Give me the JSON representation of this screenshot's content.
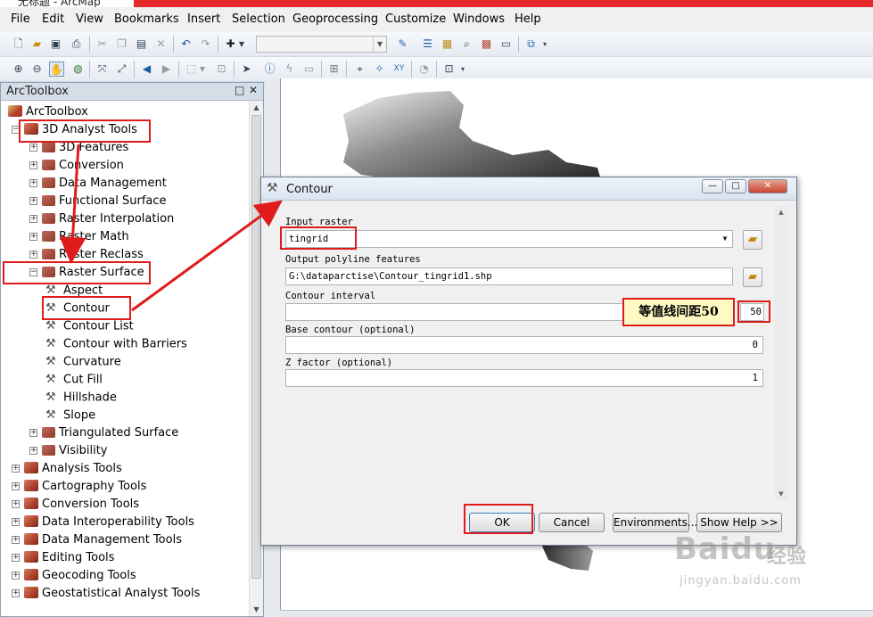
{
  "window": {
    "title_fragment": "无标题 - ArcMap"
  },
  "menu": [
    "File",
    "Edit",
    "View",
    "Bookmarks",
    "Insert",
    "Selection",
    "Geoprocessing",
    "Customize",
    "Windows",
    "Help"
  ],
  "toolbox_panel": {
    "title": "ArcToolbox",
    "pin_label": "□",
    "close_label": "✕",
    "root": "ArcToolbox",
    "items": [
      {
        "label": "3D Analyst Tools",
        "level": 0,
        "expanded": true,
        "kind": "toolbox"
      },
      {
        "label": "3D Features",
        "level": 1,
        "expanded": false,
        "kind": "toolset"
      },
      {
        "label": "Conversion",
        "level": 1,
        "expanded": false,
        "kind": "toolset"
      },
      {
        "label": "Data Management",
        "level": 1,
        "expanded": false,
        "kind": "toolset"
      },
      {
        "label": "Functional Surface",
        "level": 1,
        "expanded": false,
        "kind": "toolset"
      },
      {
        "label": "Raster Interpolation",
        "level": 1,
        "expanded": false,
        "kind": "toolset"
      },
      {
        "label": "Raster Math",
        "level": 1,
        "expanded": false,
        "kind": "toolset"
      },
      {
        "label": "Raster Reclass",
        "level": 1,
        "expanded": false,
        "kind": "toolset"
      },
      {
        "label": "Raster Surface",
        "level": 1,
        "expanded": true,
        "kind": "toolset"
      },
      {
        "label": "Aspect",
        "level": 2,
        "kind": "tool"
      },
      {
        "label": "Contour",
        "level": 2,
        "kind": "tool"
      },
      {
        "label": "Contour List",
        "level": 2,
        "kind": "tool"
      },
      {
        "label": "Contour with Barriers",
        "level": 2,
        "kind": "tool"
      },
      {
        "label": "Curvature",
        "level": 2,
        "kind": "tool"
      },
      {
        "label": "Cut Fill",
        "level": 2,
        "kind": "tool"
      },
      {
        "label": "Hillshade",
        "level": 2,
        "kind": "tool"
      },
      {
        "label": "Slope",
        "level": 2,
        "kind": "tool"
      },
      {
        "label": "Triangulated Surface",
        "level": 1,
        "expanded": false,
        "kind": "toolset"
      },
      {
        "label": "Visibility",
        "level": 1,
        "expanded": false,
        "kind": "toolset"
      },
      {
        "label": "Analysis Tools",
        "level": 0,
        "expanded": false,
        "kind": "toolbox"
      },
      {
        "label": "Cartography Tools",
        "level": 0,
        "expanded": false,
        "kind": "toolbox"
      },
      {
        "label": "Conversion Tools",
        "level": 0,
        "expanded": false,
        "kind": "toolbox"
      },
      {
        "label": "Data Interoperability Tools",
        "level": 0,
        "expanded": false,
        "kind": "toolbox"
      },
      {
        "label": "Data Management Tools",
        "level": 0,
        "expanded": false,
        "kind": "toolbox"
      },
      {
        "label": "Editing Tools",
        "level": 0,
        "expanded": false,
        "kind": "toolbox"
      },
      {
        "label": "Geocoding Tools",
        "level": 0,
        "expanded": false,
        "kind": "toolbox"
      },
      {
        "label": "Geostatistical Analyst Tools",
        "level": 0,
        "expanded": false,
        "kind": "toolbox"
      }
    ]
  },
  "dialog": {
    "title": "Contour",
    "minimize_label": "—",
    "maximize_label": "□",
    "close_label": "✕",
    "fields": {
      "input_raster_label": "Input raster",
      "input_raster_value": "tingrid",
      "output_label": "Output polyline features",
      "output_value": "G:\\dataparctise\\Contour_tingrid1.shp",
      "interval_label": "Contour interval",
      "interval_value": "50",
      "base_label": "Base contour (optional)",
      "base_value": "0",
      "zfactor_label": "Z factor (optional)",
      "zfactor_value": "1"
    },
    "buttons": {
      "ok": "OK",
      "cancel": "Cancel",
      "environments": "Environments...",
      "show_help": "Show Help >>"
    }
  },
  "annotation": {
    "text": "等值线间距50"
  },
  "watermark": {
    "brand": "Baidu",
    "cn": "经验",
    "url": "jingyan.baidu.com"
  },
  "colors": {
    "highlight_red": "#e01b1b",
    "annotation_bg": "#fff9c4",
    "toolbox_red": "#b0452e"
  },
  "icons": {
    "toolbar1": [
      "new-document-icon",
      "open-folder-icon",
      "save-icon",
      "print-icon",
      "cut-icon",
      "copy-icon",
      "paste-icon",
      "delete-icon",
      "undo-icon",
      "redo-icon",
      "add-data-icon"
    ],
    "toolbar2": [
      "zoom-in-icon",
      "zoom-out-icon",
      "pan-icon",
      "full-extent-icon",
      "fixed-zoom-in-icon",
      "fixed-zoom-out-icon",
      "back-icon",
      "forward-icon",
      "select-features-icon",
      "select-elements-icon",
      "identify-icon",
      "hyperlink-icon",
      "html-popup-icon",
      "measure-icon",
      "find-icon",
      "go-to-xy-icon",
      "time-slider-icon",
      "viewer-window-icon"
    ]
  }
}
